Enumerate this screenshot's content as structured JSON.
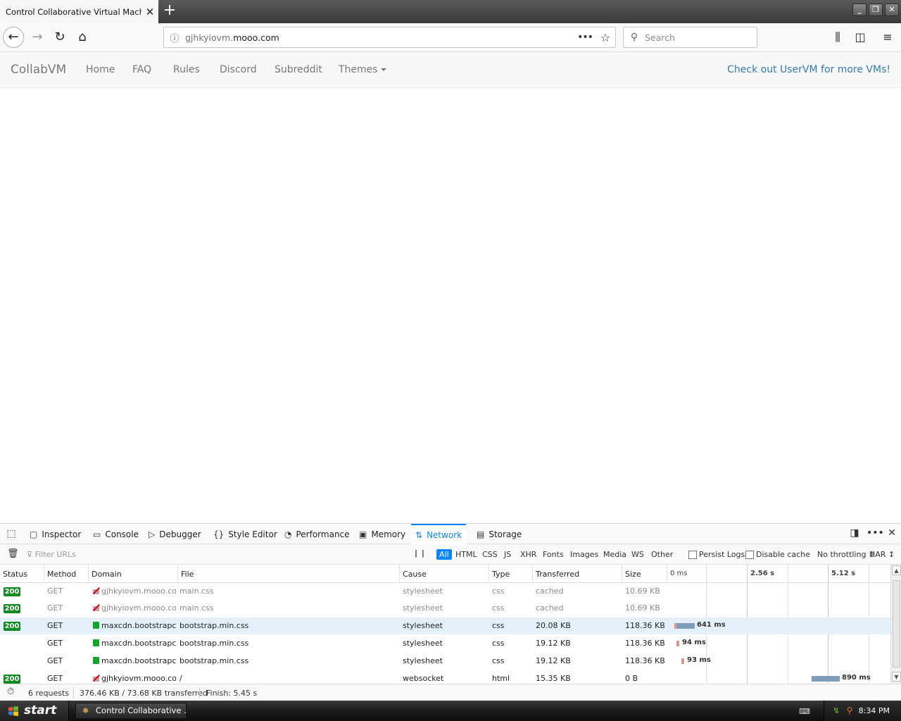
{
  "browser": {
    "tab_title": "Control Collaborative Virtual Machines!",
    "url_host_prefix": "gjhkyiovm.",
    "url_host_domain": "mooo.com",
    "search_placeholder": "Search"
  },
  "site": {
    "brand": "CollabVM",
    "nav": [
      "Home",
      "FAQ",
      "Rules",
      "Discord",
      "Subreddit",
      "Themes"
    ],
    "right_link": "Check out UserVM for more VMs!"
  },
  "devtools": {
    "tabs": [
      "Inspector",
      "Console",
      "Debugger",
      "Style Editor",
      "Performance",
      "Memory",
      "Network",
      "Storage"
    ],
    "selected_tab": "Network",
    "filter_placeholder": "Filter URLs",
    "type_filters": [
      "All",
      "HTML",
      "CSS",
      "JS",
      "XHR",
      "Fonts",
      "Images",
      "Media",
      "WS",
      "Other"
    ],
    "persist_logs": "Persist Logs",
    "disable_cache": "Disable cache",
    "throttling": "No throttling ↕",
    "har": "HAR ↕",
    "columns": [
      "Status",
      "Method",
      "Domain",
      "File",
      "Cause",
      "Type",
      "Transferred",
      "Size"
    ],
    "timeline_ticks": [
      "0 ms",
      "2.56 s",
      "5.12 s"
    ],
    "requests": [
      {
        "status": "200",
        "method": "GET",
        "domain": "gjhkyiovm.mooo.com",
        "secure": false,
        "file": "main.css",
        "cause": "stylesheet",
        "type": "css",
        "transferred": "cached",
        "size": "10.69 KB",
        "timing": "",
        "cached": true
      },
      {
        "status": "200",
        "method": "GET",
        "domain": "gjhkyiovm.mooo.com",
        "secure": false,
        "file": "main.css",
        "cause": "stylesheet",
        "type": "css",
        "transferred": "cached",
        "size": "10.69 KB",
        "timing": "",
        "cached": true
      },
      {
        "status": "200",
        "method": "GET",
        "domain": "maxcdn.bootstrapc...",
        "secure": true,
        "file": "bootstrap.min.css",
        "cause": "stylesheet",
        "type": "css",
        "transferred": "20.08 KB",
        "size": "118.36 KB",
        "timing": "641 ms",
        "cached": false
      },
      {
        "status": "",
        "method": "GET",
        "domain": "maxcdn.bootstrapc...",
        "secure": true,
        "file": "bootstrap.min.css",
        "cause": "stylesheet",
        "type": "css",
        "transferred": "19.12 KB",
        "size": "118.36 KB",
        "timing": "94 ms",
        "cached": false
      },
      {
        "status": "",
        "method": "GET",
        "domain": "maxcdn.bootstrapc...",
        "secure": true,
        "file": "bootstrap.min.css",
        "cause": "stylesheet",
        "type": "css",
        "transferred": "19.12 KB",
        "size": "118.36 KB",
        "timing": "93 ms",
        "cached": false
      },
      {
        "status": "200",
        "method": "GET",
        "domain": "gjhkyiovm.mooo.com",
        "secure": false,
        "file": "/",
        "cause": "websocket",
        "type": "html",
        "transferred": "15.35 KB",
        "size": "0 B",
        "timing": "890 ms",
        "cached": false
      }
    ],
    "summary": {
      "requests": "6 requests",
      "transferred": "376.46 KB / 73.68 KB transferred",
      "finish": "Finish: 5.45 s"
    }
  },
  "taskbar": {
    "start_label": "start",
    "window_title": "Control Collaborative ...",
    "clock": "8:34 PM"
  },
  "colors": {
    "accent": "#0a84ff",
    "status_ok": "#118a20",
    "link": "#337ab7"
  }
}
